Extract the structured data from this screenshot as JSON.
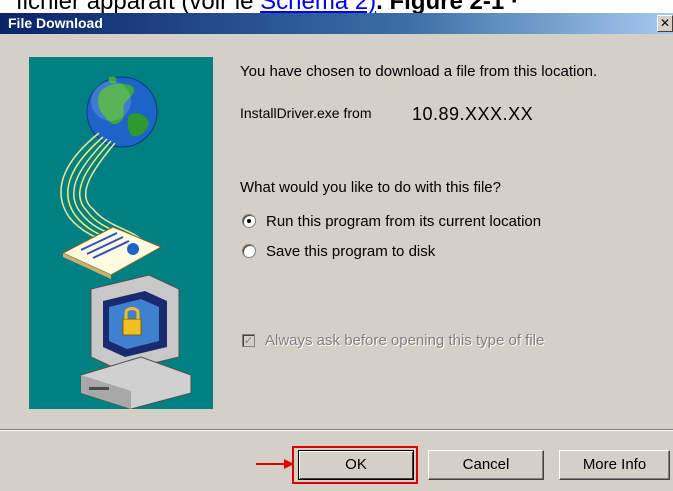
{
  "document_strip": {
    "prefix": "fichier apparaît (voir le ",
    "link": "Schéma 2)",
    "suffix": ". Figure 2-1 ·"
  },
  "dialog": {
    "title": "File Download",
    "close_glyph": "✕",
    "message": "You have chosen to download a file from this location.",
    "file_name": "InstallDriver.exe from",
    "file_host": "10.89.XXX.XX",
    "question": "What would you like to do with this file?",
    "options": [
      {
        "label": "Run this program from its current location",
        "checked": true
      },
      {
        "label": "Save this program to disk",
        "checked": false
      }
    ],
    "always_ask": {
      "label": "Always ask before opening this type of file",
      "checked": true,
      "disabled": true
    },
    "check_glyph": "✓",
    "buttons": {
      "ok": "OK",
      "cancel": "Cancel",
      "more_info": "More Info"
    }
  },
  "colors": {
    "titlebar_start": "#0a246a",
    "illustration_bg": "#008080",
    "highlight": "#e00000"
  }
}
